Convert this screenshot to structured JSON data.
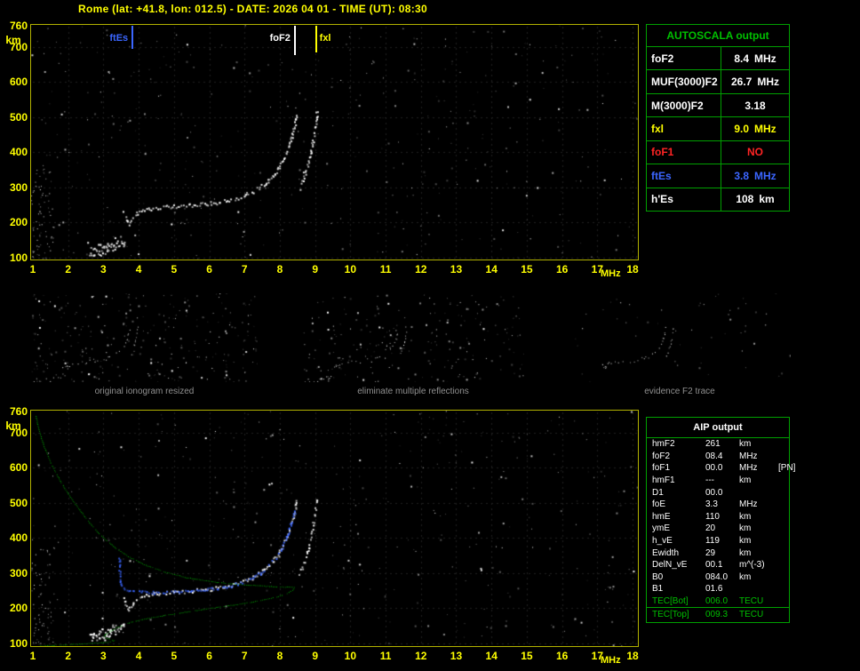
{
  "header": {
    "title": "Rome (lat: +41.8, lon: 012.5) - DATE: 2026 04 01 - TIME (UT): 08:30"
  },
  "colors": {
    "yellow": "#ffff00",
    "frame_yellow": "#b2b200",
    "green": "#00c000",
    "panel_green": "#00a000",
    "blue": "#3b66ff",
    "red": "#ff2424",
    "white": "#ffffff",
    "caption_gray": "#8f8f8f"
  },
  "autoscala": {
    "title": "AUTOSCALA output",
    "rows": [
      {
        "label": "foF2",
        "value": "8.4",
        "unit": "MHz",
        "color": "white"
      },
      {
        "label": "MUF(3000)F2",
        "value": "26.7",
        "unit": "MHz",
        "color": "white"
      },
      {
        "label": "M(3000)F2",
        "value": "3.18",
        "unit": "",
        "color": "white"
      },
      {
        "label": "fxl",
        "value": "9.0",
        "unit": "MHz",
        "color": "yellow"
      },
      {
        "label": "foF1",
        "value": "NO",
        "unit": "",
        "color": "red"
      },
      {
        "label": "ftEs",
        "value": "3.8",
        "unit": "MHz",
        "color": "blue"
      },
      {
        "label": "h'Es",
        "value": "108",
        "unit": "km",
        "color": "white"
      }
    ]
  },
  "aip": {
    "title": "AIP output",
    "rows": [
      {
        "name": "hmF2",
        "value": "261",
        "unit": "km",
        "extra": "",
        "color": "white"
      },
      {
        "name": "foF2",
        "value": "08.4",
        "unit": "MHz",
        "extra": "",
        "color": "white"
      },
      {
        "name": "foF1",
        "value": "00.0",
        "unit": "MHz",
        "extra": "[PN]",
        "color": "white"
      },
      {
        "name": "hmF1",
        "value": "---",
        "unit": "km",
        "extra": "",
        "color": "white"
      },
      {
        "name": "D1",
        "value": "00.0",
        "unit": "",
        "extra": "",
        "color": "white"
      },
      {
        "name": "foE",
        "value": "3.3",
        "unit": "MHz",
        "extra": "",
        "color": "white"
      },
      {
        "name": "hmE",
        "value": "110",
        "unit": "km",
        "extra": "",
        "color": "white"
      },
      {
        "name": "ymE",
        "value": "20",
        "unit": "km",
        "extra": "",
        "color": "white"
      },
      {
        "name": "h_vE",
        "value": "119",
        "unit": "km",
        "extra": "",
        "color": "white"
      },
      {
        "name": "Ewidth",
        "value": "29",
        "unit": "km",
        "extra": "",
        "color": "white"
      },
      {
        "name": "DelN_vE",
        "value": "00.1",
        "unit": "m^(-3)",
        "extra": "",
        "color": "white"
      },
      {
        "name": "B0",
        "value": "084.0",
        "unit": "km",
        "extra": "",
        "color": "white"
      },
      {
        "name": "B1",
        "value": "01.6",
        "unit": "",
        "extra": "",
        "color": "white"
      },
      {
        "name": "TEC[Bot]",
        "value": "006.0",
        "unit": "TECU",
        "extra": "",
        "color": "green",
        "separator": true
      },
      {
        "name": "TEC[Top]",
        "value": "009.3",
        "unit": "TECU",
        "extra": "",
        "color": "green"
      }
    ]
  },
  "thumbnails": [
    {
      "caption": "original ionogram resized"
    },
    {
      "caption": "eliminate multiple reflections"
    },
    {
      "caption": "evidence F2 trace"
    }
  ],
  "chart_data": [
    {
      "id": "top_ionogram",
      "type": "scatter",
      "title": "scaled ionogram with autoscala frequency markers",
      "xlabel": "MHz",
      "ylabel": "km",
      "xlim": [
        1,
        18
      ],
      "ylim": [
        100,
        760
      ],
      "x_ticks": [
        1,
        2,
        3,
        4,
        5,
        6,
        7,
        8,
        9,
        10,
        11,
        12,
        13,
        14,
        15,
        16,
        17,
        18
      ],
      "y_ticks": [
        760,
        700,
        600,
        500,
        400,
        300,
        200,
        100
      ],
      "grid": false,
      "markers": [
        {
          "label": "ftEs",
          "freq_mhz": 3.8,
          "color": "blue",
          "side": "left",
          "line_len": 26
        },
        {
          "label": "foF2",
          "freq_mhz": 8.4,
          "color": "white",
          "side": "left",
          "line_len": 33
        },
        {
          "label": "fxl",
          "freq_mhz": 9.0,
          "color": "yellow",
          "side": "right",
          "line_len": 30
        }
      ],
      "series": [
        {
          "name": "low-frequency-echoes",
          "color": "white",
          "points": [
            [
              1.15,
              102
            ],
            [
              1.6,
              106
            ],
            [
              2.1,
              103
            ],
            [
              2.55,
              107
            ]
          ],
          "size": 1,
          "step": 5,
          "jitter": 3,
          "yjitter": 5,
          "density": 0.35
        },
        {
          "name": "Es-layer-echo",
          "color": "white",
          "points": [
            [
              2.62,
              116
            ],
            [
              2.8,
              122
            ],
            [
              3.0,
              128
            ],
            [
              3.2,
              135
            ],
            [
              3.35,
              142
            ],
            [
              3.5,
              150
            ],
            [
              3.6,
              157
            ]
          ],
          "size": 2,
          "step": 1.5,
          "jitter": 1.6,
          "yjitter": 7,
          "density": 0.95,
          "passes": 2
        },
        {
          "name": "F-region-o-trace",
          "color": "white",
          "points": [
            [
              3.55,
              232
            ],
            [
              3.6,
              218
            ],
            [
              3.66,
              204
            ],
            [
              3.72,
              199
            ],
            [
              3.78,
              207
            ],
            [
              3.85,
              218
            ],
            [
              3.93,
              227
            ],
            [
              4.05,
              233
            ],
            [
              4.25,
              239
            ],
            [
              4.5,
              243
            ],
            [
              4.8,
              246
            ],
            [
              5.1,
              248
            ],
            [
              5.4,
              250
            ],
            [
              5.7,
              253
            ],
            [
              6.0,
              256
            ],
            [
              6.3,
              260
            ],
            [
              6.6,
              266
            ],
            [
              6.9,
              275
            ],
            [
              7.15,
              286
            ],
            [
              7.4,
              300
            ],
            [
              7.6,
              316
            ],
            [
              7.8,
              336
            ],
            [
              7.97,
              358
            ],
            [
              8.1,
              382
            ],
            [
              8.2,
              408
            ],
            [
              8.3,
              438
            ],
            [
              8.38,
              468
            ],
            [
              8.44,
              496
            ],
            [
              8.48,
              515
            ]
          ],
          "size": 2,
          "step": 2,
          "jitter": 1.1,
          "yjitter": 2,
          "density": 0.85
        },
        {
          "name": "F-region-x-trace",
          "color": "white",
          "points": [
            [
              8.55,
              300
            ],
            [
              8.62,
              318
            ],
            [
              8.7,
              340
            ],
            [
              8.78,
              365
            ],
            [
              8.85,
              395
            ],
            [
              8.91,
              425
            ],
            [
              8.96,
              455
            ],
            [
              9.0,
              485
            ],
            [
              9.03,
              508
            ],
            [
              9.05,
              522
            ]
          ],
          "size": 2,
          "step": 2.2,
          "jitter": 1.0,
          "yjitter": 2,
          "density": 0.8
        }
      ]
    },
    {
      "id": "bottom_ionogram",
      "type": "scatter",
      "title": "ionogram with restored trace and electron density profile",
      "xlabel": "MHz",
      "ylabel": "km",
      "xlim": [
        1,
        18
      ],
      "ylim": [
        100,
        760
      ],
      "x_ticks": [
        1,
        2,
        3,
        4,
        5,
        6,
        7,
        8,
        9,
        10,
        11,
        12,
        13,
        14,
        15,
        16,
        17,
        18
      ],
      "y_ticks": [
        760,
        700,
        600,
        500,
        400,
        300,
        200,
        100
      ],
      "grid": false,
      "markers": [],
      "series": [
        {
          "name": "Es-layer-echo",
          "color": "white",
          "points": [
            [
              2.62,
              116
            ],
            [
              2.8,
              122
            ],
            [
              3.0,
              128
            ],
            [
              3.2,
              135
            ],
            [
              3.35,
              142
            ],
            [
              3.5,
              150
            ],
            [
              3.6,
              157
            ]
          ],
          "size": 2,
          "step": 1.5,
          "jitter": 1.6,
          "yjitter": 7,
          "density": 0.95,
          "passes": 2
        },
        {
          "name": "F-region-o-trace",
          "color": "white",
          "points": [
            [
              3.55,
              232
            ],
            [
              3.6,
              218
            ],
            [
              3.66,
              204
            ],
            [
              3.72,
              199
            ],
            [
              3.78,
              207
            ],
            [
              3.85,
              218
            ],
            [
              3.93,
              227
            ],
            [
              4.05,
              233
            ],
            [
              4.25,
              239
            ],
            [
              4.5,
              243
            ],
            [
              4.8,
              246
            ],
            [
              5.1,
              248
            ],
            [
              5.4,
              250
            ],
            [
              5.7,
              253
            ],
            [
              6.0,
              256
            ],
            [
              6.3,
              260
            ],
            [
              6.6,
              266
            ],
            [
              6.9,
              275
            ],
            [
              7.15,
              286
            ],
            [
              7.4,
              300
            ],
            [
              7.6,
              316
            ],
            [
              7.8,
              336
            ],
            [
              7.97,
              358
            ],
            [
              8.1,
              382
            ],
            [
              8.2,
              408
            ],
            [
              8.3,
              438
            ],
            [
              8.38,
              468
            ],
            [
              8.44,
              496
            ],
            [
              8.48,
              515
            ]
          ],
          "size": 2,
          "step": 2,
          "jitter": 1.1,
          "yjitter": 2,
          "density": 0.85
        },
        {
          "name": "F-region-x-trace",
          "color": "white",
          "points": [
            [
              8.55,
              300
            ],
            [
              8.62,
              318
            ],
            [
              8.7,
              340
            ],
            [
              8.78,
              365
            ],
            [
              8.85,
              395
            ],
            [
              8.91,
              425
            ],
            [
              8.96,
              455
            ],
            [
              9.0,
              485
            ],
            [
              9.03,
              508
            ],
            [
              9.05,
              522
            ]
          ],
          "size": 2,
          "step": 2.2,
          "jitter": 1.0,
          "yjitter": 2,
          "density": 0.8
        },
        {
          "name": "restored-trace",
          "color": "blue",
          "points": [
            [
              3.44,
              352
            ],
            [
              3.44,
              322
            ],
            [
              3.45,
              295
            ],
            [
              3.47,
              272
            ],
            [
              3.55,
              260
            ],
            [
              3.7,
              254
            ],
            [
              3.9,
              250
            ],
            [
              4.2,
              247
            ],
            [
              4.6,
              246
            ],
            [
              5.0,
              248
            ],
            [
              5.4,
              251
            ],
            [
              5.8,
              254
            ],
            [
              6.2,
              258
            ],
            [
              6.6,
              265
            ],
            [
              6.95,
              276
            ],
            [
              7.25,
              290
            ],
            [
              7.5,
              306
            ],
            [
              7.72,
              326
            ],
            [
              7.92,
              350
            ],
            [
              8.08,
              378
            ],
            [
              8.2,
              408
            ],
            [
              8.3,
              440
            ],
            [
              8.38,
              466
            ],
            [
              8.43,
              484
            ]
          ],
          "size": 2,
          "step": 2,
          "jitter": 1.0,
          "yjitter": 1.5,
          "density": 0.8
        },
        {
          "name": "electron-density-profile",
          "color": "green",
          "points": [
            [
              1.08,
              748
            ],
            [
              1.15,
              715
            ],
            [
              1.25,
              680
            ],
            [
              1.36,
              648
            ],
            [
              1.5,
              615
            ],
            [
              1.65,
              585
            ],
            [
              1.82,
              555
            ],
            [
              2.0,
              525
            ],
            [
              2.2,
              497
            ],
            [
              2.4,
              470
            ],
            [
              2.6,
              445
            ],
            [
              2.8,
              420
            ],
            [
              3.05,
              396
            ],
            [
              3.35,
              372
            ],
            [
              3.7,
              348
            ],
            [
              4.15,
              325
            ],
            [
              4.7,
              305
            ],
            [
              5.35,
              288
            ],
            [
              6.1,
              276
            ],
            [
              6.9,
              268
            ],
            [
              7.7,
              263
            ],
            [
              8.25,
              261
            ],
            [
              8.4,
              260
            ],
            [
              8.35,
              252
            ],
            [
              8.2,
              243
            ],
            [
              7.9,
              233
            ],
            [
              7.5,
              224
            ],
            [
              7.0,
              215
            ],
            [
              6.4,
              206
            ],
            [
              5.8,
              197
            ],
            [
              5.2,
              188
            ],
            [
              4.65,
              179
            ],
            [
              4.15,
              170
            ],
            [
              3.78,
              161
            ],
            [
              3.52,
              152
            ],
            [
              3.32,
              143
            ],
            [
              3.16,
              134
            ],
            [
              3.06,
              127
            ],
            [
              3.0,
              121
            ],
            [
              3.05,
              117
            ],
            [
              3.2,
              112
            ],
            [
              3.3,
              109
            ],
            [
              3.18,
              105
            ],
            [
              2.85,
              102
            ],
            [
              2.35,
              99
            ],
            [
              1.7,
              96
            ],
            [
              1.1,
              93
            ]
          ],
          "size": 1,
          "step": 2,
          "jitter": 0.3,
          "yjitter": 0.3,
          "density": 0.85
        }
      ]
    }
  ]
}
